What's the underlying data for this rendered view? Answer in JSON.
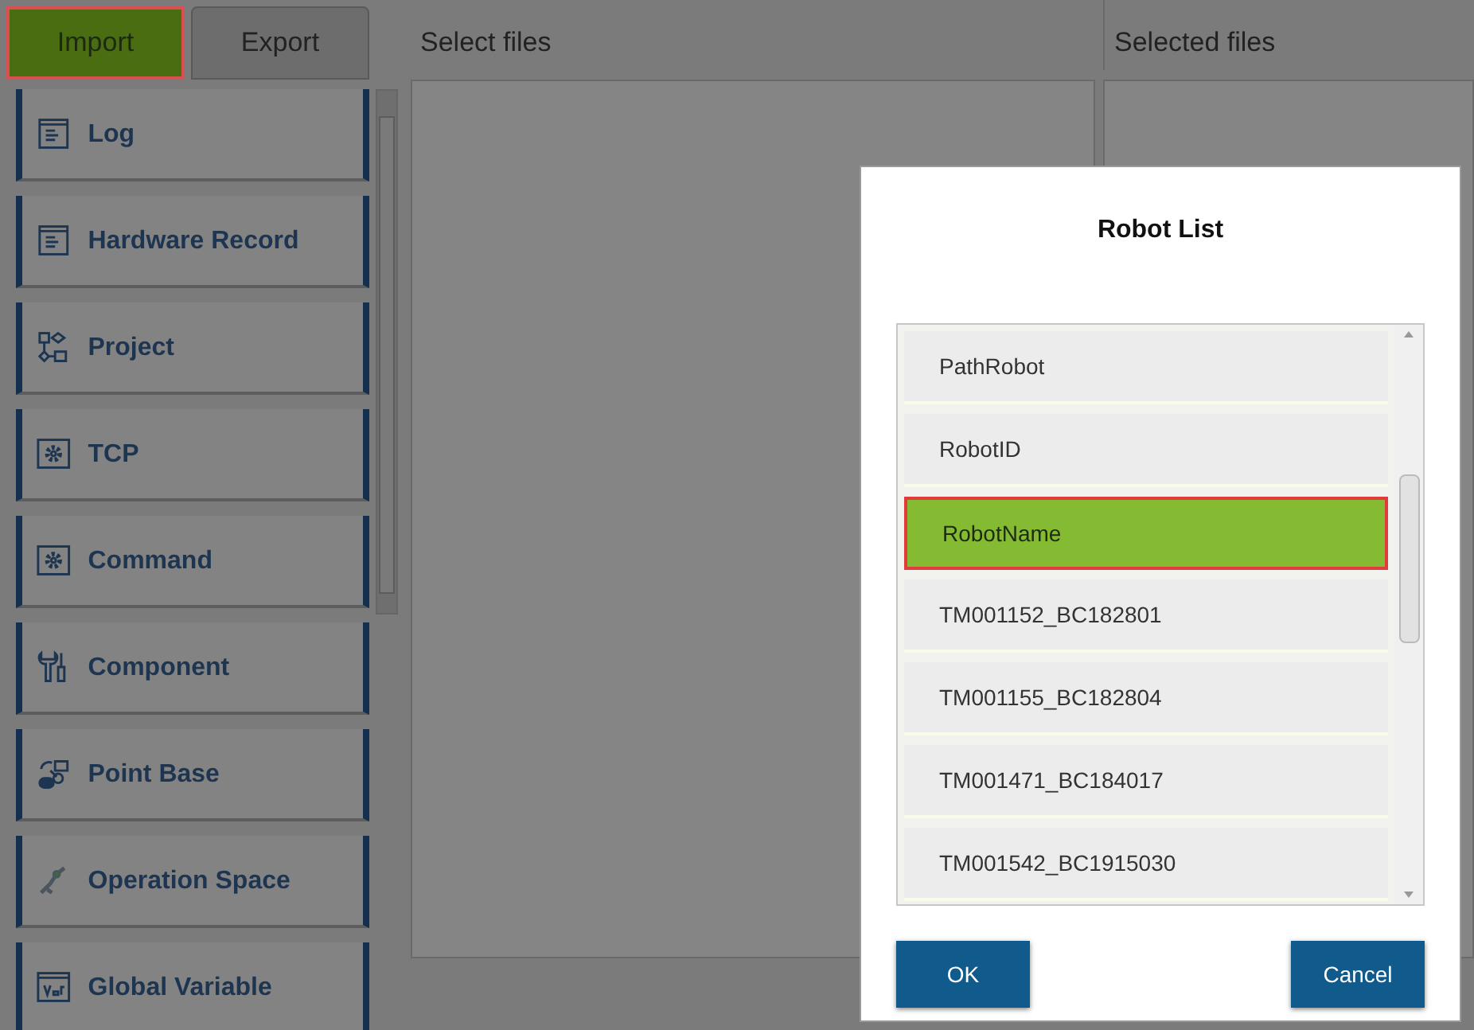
{
  "tabs": [
    {
      "label": "Import",
      "selected": true
    },
    {
      "label": "Export",
      "selected": false
    }
  ],
  "nav_items": [
    {
      "label": "Log"
    },
    {
      "label": "Hardware Record"
    },
    {
      "label": "Project"
    },
    {
      "label": "TCP"
    },
    {
      "label": "Command"
    },
    {
      "label": "Component"
    },
    {
      "label": "Point Base"
    },
    {
      "label": "Operation Space"
    },
    {
      "label": "Global Variable"
    }
  ],
  "select_panel": {
    "title": "Select files"
  },
  "selected_panel": {
    "title": "Selected files"
  },
  "dialog": {
    "title": "Robot List",
    "items": [
      {
        "label": "PathRobot",
        "selected": false
      },
      {
        "label": "RobotID",
        "selected": false
      },
      {
        "label": "RobotName",
        "selected": true
      },
      {
        "label": "TM001152_BC182801",
        "selected": false
      },
      {
        "label": "TM001155_BC182804",
        "selected": false
      },
      {
        "label": "TM001471_BC184017",
        "selected": false
      },
      {
        "label": "TM001542_BC1915030",
        "selected": false
      }
    ],
    "buttons": [
      "OK",
      "Cancel"
    ]
  }
}
